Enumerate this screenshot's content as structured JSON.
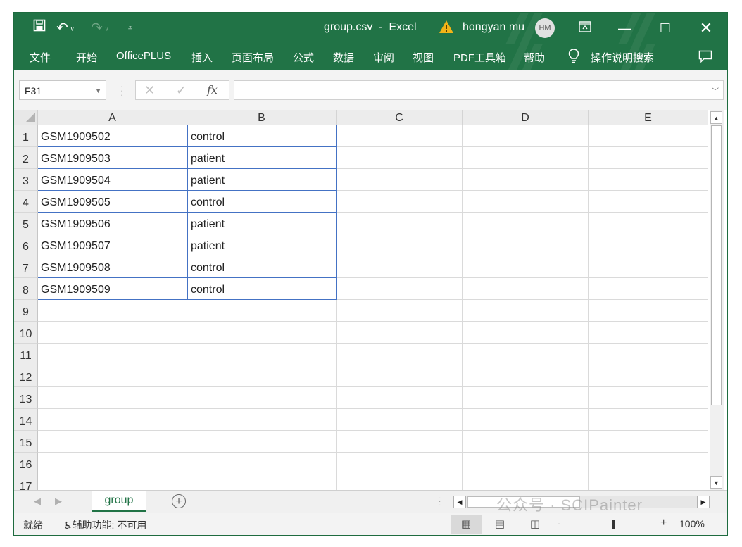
{
  "titlebar": {
    "filename": "group.csv",
    "separator": "-",
    "app": "Excel",
    "user_name": "hongyan mu",
    "user_initials": "HM"
  },
  "ribbon_tabs": [
    "文件",
    "开始",
    "OfficePLUS",
    "插入",
    "页面布局",
    "公式",
    "数据",
    "审阅",
    "视图",
    "PDF工具箱",
    "帮助",
    "操作说明搜索"
  ],
  "formula_bar": {
    "name_box": "F31",
    "fx_label": "fx",
    "formula_value": ""
  },
  "columns": [
    "A",
    "B",
    "C",
    "D",
    "E"
  ],
  "rows": [
    "1",
    "2",
    "3",
    "4",
    "5",
    "6",
    "7",
    "8",
    "9",
    "10",
    "11",
    "12",
    "13",
    "14",
    "15",
    "16",
    "17"
  ],
  "cells": [
    [
      "GSM1909502",
      "control"
    ],
    [
      "GSM1909503",
      "patient"
    ],
    [
      "GSM1909504",
      "patient"
    ],
    [
      "GSM1909505",
      "control"
    ],
    [
      "GSM1909506",
      "patient"
    ],
    [
      "GSM1909507",
      "patient"
    ],
    [
      "GSM1909508",
      "control"
    ],
    [
      "GSM1909509",
      "control"
    ]
  ],
  "sheets": [
    "group"
  ],
  "status": {
    "ready": "就绪",
    "accessibility": "辅助功能: 不可用",
    "zoom": "100%",
    "zoom_minus": "-",
    "zoom_plus": "+"
  },
  "watermark": "公众号 · SCIPainter",
  "colors": {
    "excel_green": "#217346",
    "selection_border": "#4472c4"
  }
}
